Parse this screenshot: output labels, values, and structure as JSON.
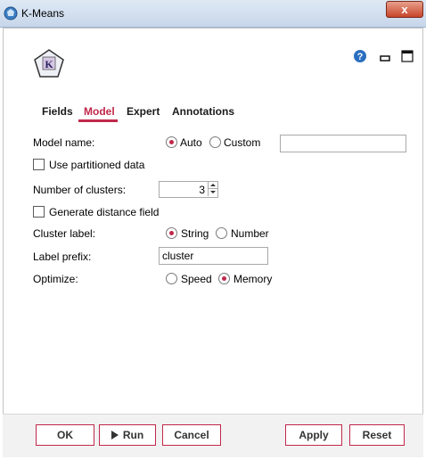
{
  "window": {
    "title": "K-Means",
    "close_glyph": "x"
  },
  "header": {
    "node_icon_letter": "K"
  },
  "tabs": [
    {
      "label": "Fields",
      "active": false
    },
    {
      "label": "Model",
      "active": true
    },
    {
      "label": "Expert",
      "active": false
    },
    {
      "label": "Annotations",
      "active": false
    }
  ],
  "form": {
    "model_name": {
      "label": "Model name:",
      "options": [
        {
          "label": "Auto",
          "selected": true
        },
        {
          "label": "Custom",
          "selected": false
        }
      ],
      "custom_value": ""
    },
    "use_partitioned": {
      "label": "Use partitioned data",
      "checked": false
    },
    "num_clusters": {
      "label": "Number of clusters:",
      "value": "3"
    },
    "generate_distance": {
      "label": "Generate distance field",
      "checked": false
    },
    "cluster_label": {
      "label": "Cluster label:",
      "options": [
        {
          "label": "String",
          "selected": true
        },
        {
          "label": "Number",
          "selected": false
        }
      ]
    },
    "label_prefix": {
      "label": "Label prefix:",
      "value": "cluster"
    },
    "optimize": {
      "label": "Optimize:",
      "options": [
        {
          "label": "Speed",
          "selected": false
        },
        {
          "label": "Memory",
          "selected": true
        }
      ]
    }
  },
  "buttons": {
    "ok": "OK",
    "run": "Run",
    "cancel": "Cancel",
    "apply": "Apply",
    "reset": "Reset"
  },
  "colors": {
    "accent": "#c0284a",
    "help": "#2a6ebf"
  },
  "icons": [
    "app-icon",
    "kmeans-node-icon",
    "help-icon",
    "minimize-icon",
    "maximize-icon",
    "close-icon",
    "run-icon"
  ]
}
